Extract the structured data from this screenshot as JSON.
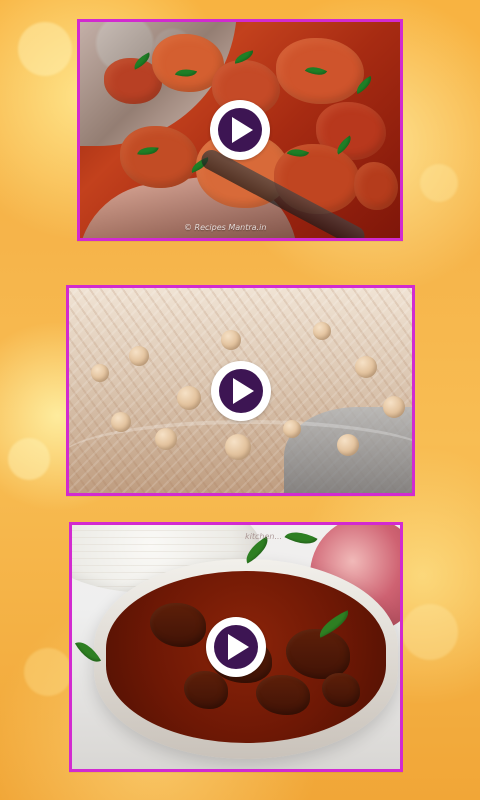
{
  "screen": {
    "background_gradient_top": "#f8b341",
    "background_gradient_bottom": "#f1a637",
    "frame_color": "#d22ad0",
    "play_button_fill": "#3d1553",
    "play_button_ring": "#ffffff"
  },
  "cards": [
    {
      "name": "chicken-curry-video",
      "watermark": "© Recipes Mantra.in"
    },
    {
      "name": "chickpea-rice-video",
      "watermark": ""
    },
    {
      "name": "mutton-curry-video",
      "watermark": "kitchen..."
    }
  ]
}
